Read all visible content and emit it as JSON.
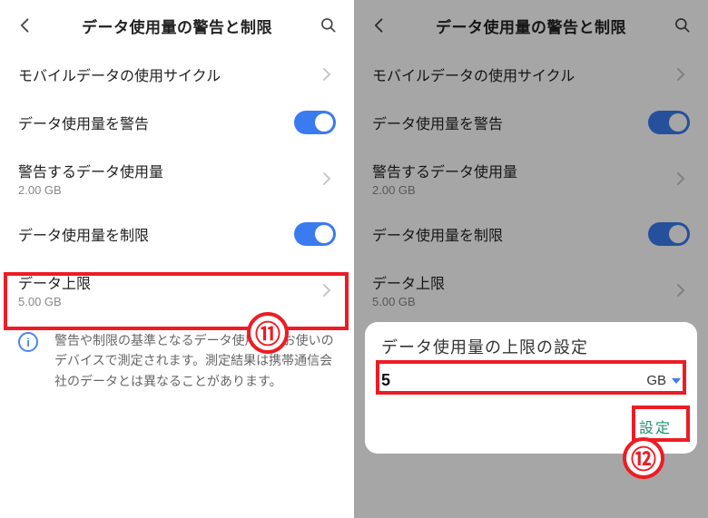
{
  "left": {
    "header": {
      "title": "データ使用量の警告と制限"
    },
    "rows": {
      "cycle": {
        "label": "モバイルデータの使用サイクル"
      },
      "warn": {
        "label": "データ使用量を警告"
      },
      "warn_amt": {
        "label": "警告するデータ使用量",
        "sub": "2.00 GB"
      },
      "limit": {
        "label": "データ使用量を制限"
      },
      "cap": {
        "label": "データ上限",
        "sub": "5.00 GB"
      }
    },
    "info": "警告や制限の基準となるデータ使用量はお使いのデバイスで測定されます。測定結果は携帯通信会社のデータとは異なることがあります。",
    "step": "⑪"
  },
  "right": {
    "header": {
      "title": "データ使用量の警告と制限"
    },
    "rows": {
      "cycle": {
        "label": "モバイルデータの使用サイクル"
      },
      "warn": {
        "label": "データ使用量を警告"
      },
      "warn_amt": {
        "label": "警告するデータ使用量",
        "sub": "2.00 GB"
      },
      "limit": {
        "label": "データ使用量を制限"
      },
      "cap": {
        "label": "データ上限",
        "sub": "5.00 GB"
      }
    },
    "dialog": {
      "title": "データ使用量の上限の設定",
      "value": "5",
      "unit": "GB",
      "confirm": "設定"
    },
    "step": "⑫"
  }
}
